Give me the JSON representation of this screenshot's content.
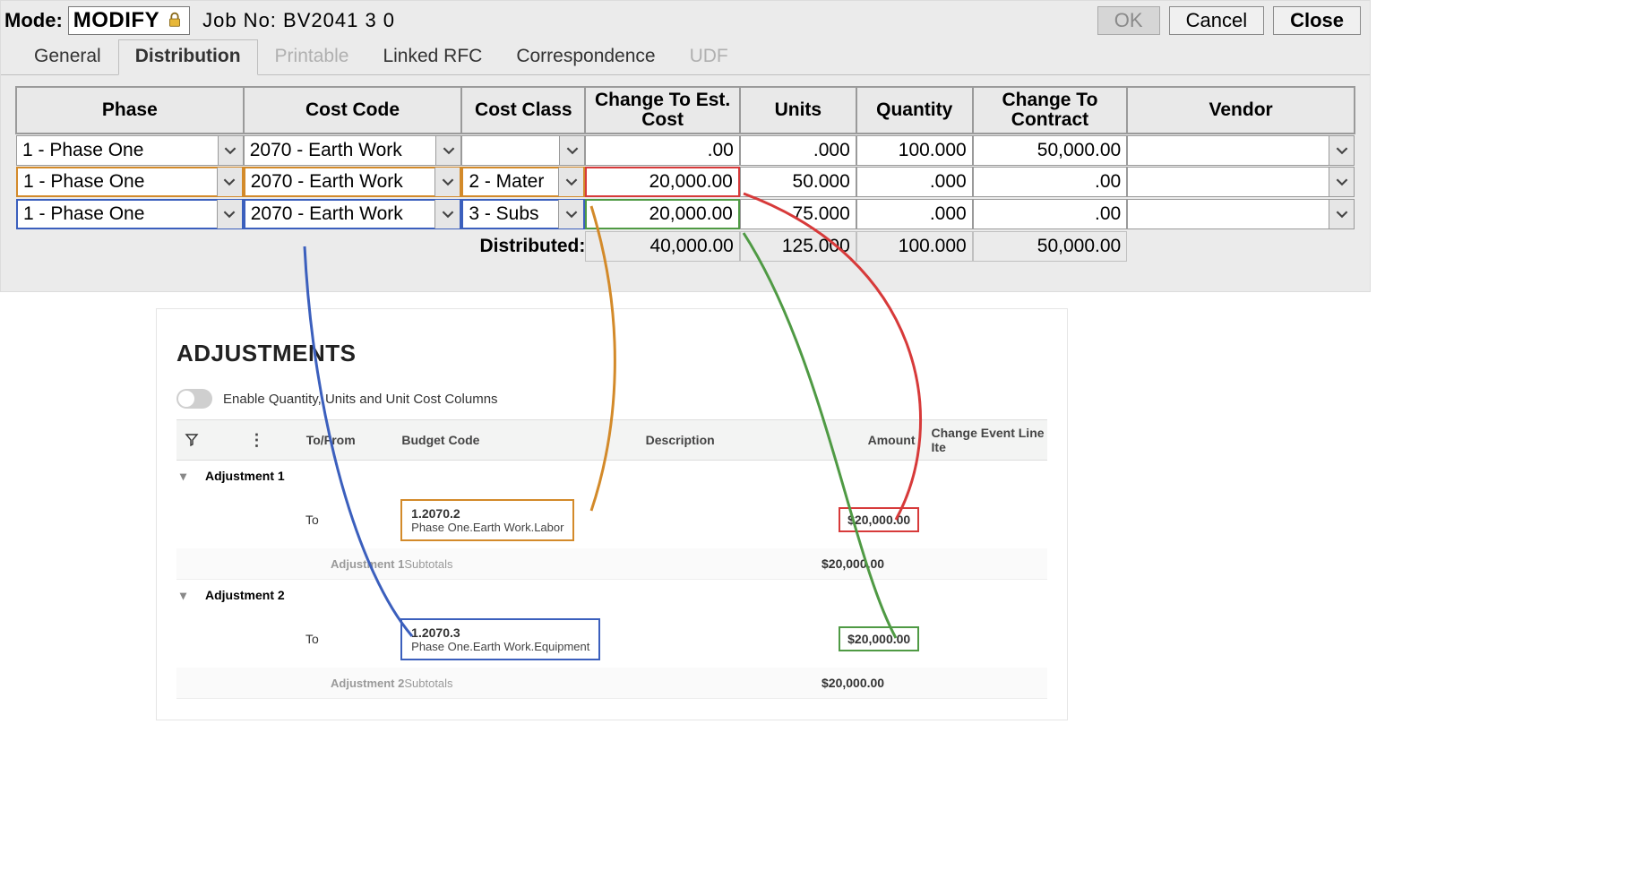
{
  "header": {
    "mode_label": "Mode:",
    "mode_value": "MODIFY",
    "job_label": "Job No:",
    "job_value": "BV2041  3  0",
    "ok": "OK",
    "cancel": "Cancel",
    "close": "Close"
  },
  "tabs": {
    "general": "General",
    "distribution": "Distribution",
    "printable": "Printable",
    "linked_rfc": "Linked RFC",
    "correspondence": "Correspondence",
    "udf": "UDF"
  },
  "grid": {
    "head": {
      "phase": "Phase",
      "cost_code": "Cost Code",
      "cost_class": "Cost Class",
      "change_est": "Change To Est. Cost",
      "units": "Units",
      "quantity": "Quantity",
      "change_contract": "Change To Contract",
      "vendor": "Vendor"
    },
    "rows": [
      {
        "phase": "1  - Phase One",
        "cost_code": "2070  - Earth Work",
        "cost_class": "",
        "change_est": ".00",
        "units": ".000",
        "quantity": "100.000",
        "change_contract": "50,000.00",
        "vendor": ""
      },
      {
        "phase": "1  - Phase One",
        "cost_code": "2070  - Earth Work",
        "cost_class": "2  - Mater",
        "change_est": "20,000.00",
        "units": "50.000",
        "quantity": ".000",
        "change_contract": ".00",
        "vendor": ""
      },
      {
        "phase": "1  - Phase One",
        "cost_code": "2070  - Earth Work",
        "cost_class": "3  - Subs",
        "change_est": "20,000.00",
        "units": "75.000",
        "quantity": ".000",
        "change_contract": ".00",
        "vendor": ""
      }
    ],
    "totals": {
      "label": "Distributed:",
      "change_est": "40,000.00",
      "units": "125.000",
      "quantity": "100.000",
      "change_contract": "50,000.00"
    }
  },
  "adjustments": {
    "title": "ADJUSTMENTS",
    "toggle_label": "Enable Quantity, Units and Unit Cost Columns",
    "head": {
      "tofrom": "To/From",
      "budget": "Budget Code",
      "description": "Description",
      "amount": "Amount",
      "cel": "Change Event Line Ite"
    },
    "groups": [
      {
        "title": "Adjustment 1",
        "tofrom": "To",
        "budget_code": "1.2070.2",
        "budget_desc": "Phase One.Earth Work.Labor",
        "amount": "$20,000.00",
        "subtotal_label_prefix": "Adjustment 1 ",
        "subtotal_label_suffix": "Subtotals",
        "subtotal_amount": "$20,000.00"
      },
      {
        "title": "Adjustment 2",
        "tofrom": "To",
        "budget_code": "1.2070.3",
        "budget_desc": "Phase One.Earth Work.Equipment",
        "amount": "$20,000.00",
        "subtotal_label_prefix": "Adjustment 2 ",
        "subtotal_label_suffix": "Subtotals",
        "subtotal_amount": "$20,000.00"
      }
    ]
  }
}
